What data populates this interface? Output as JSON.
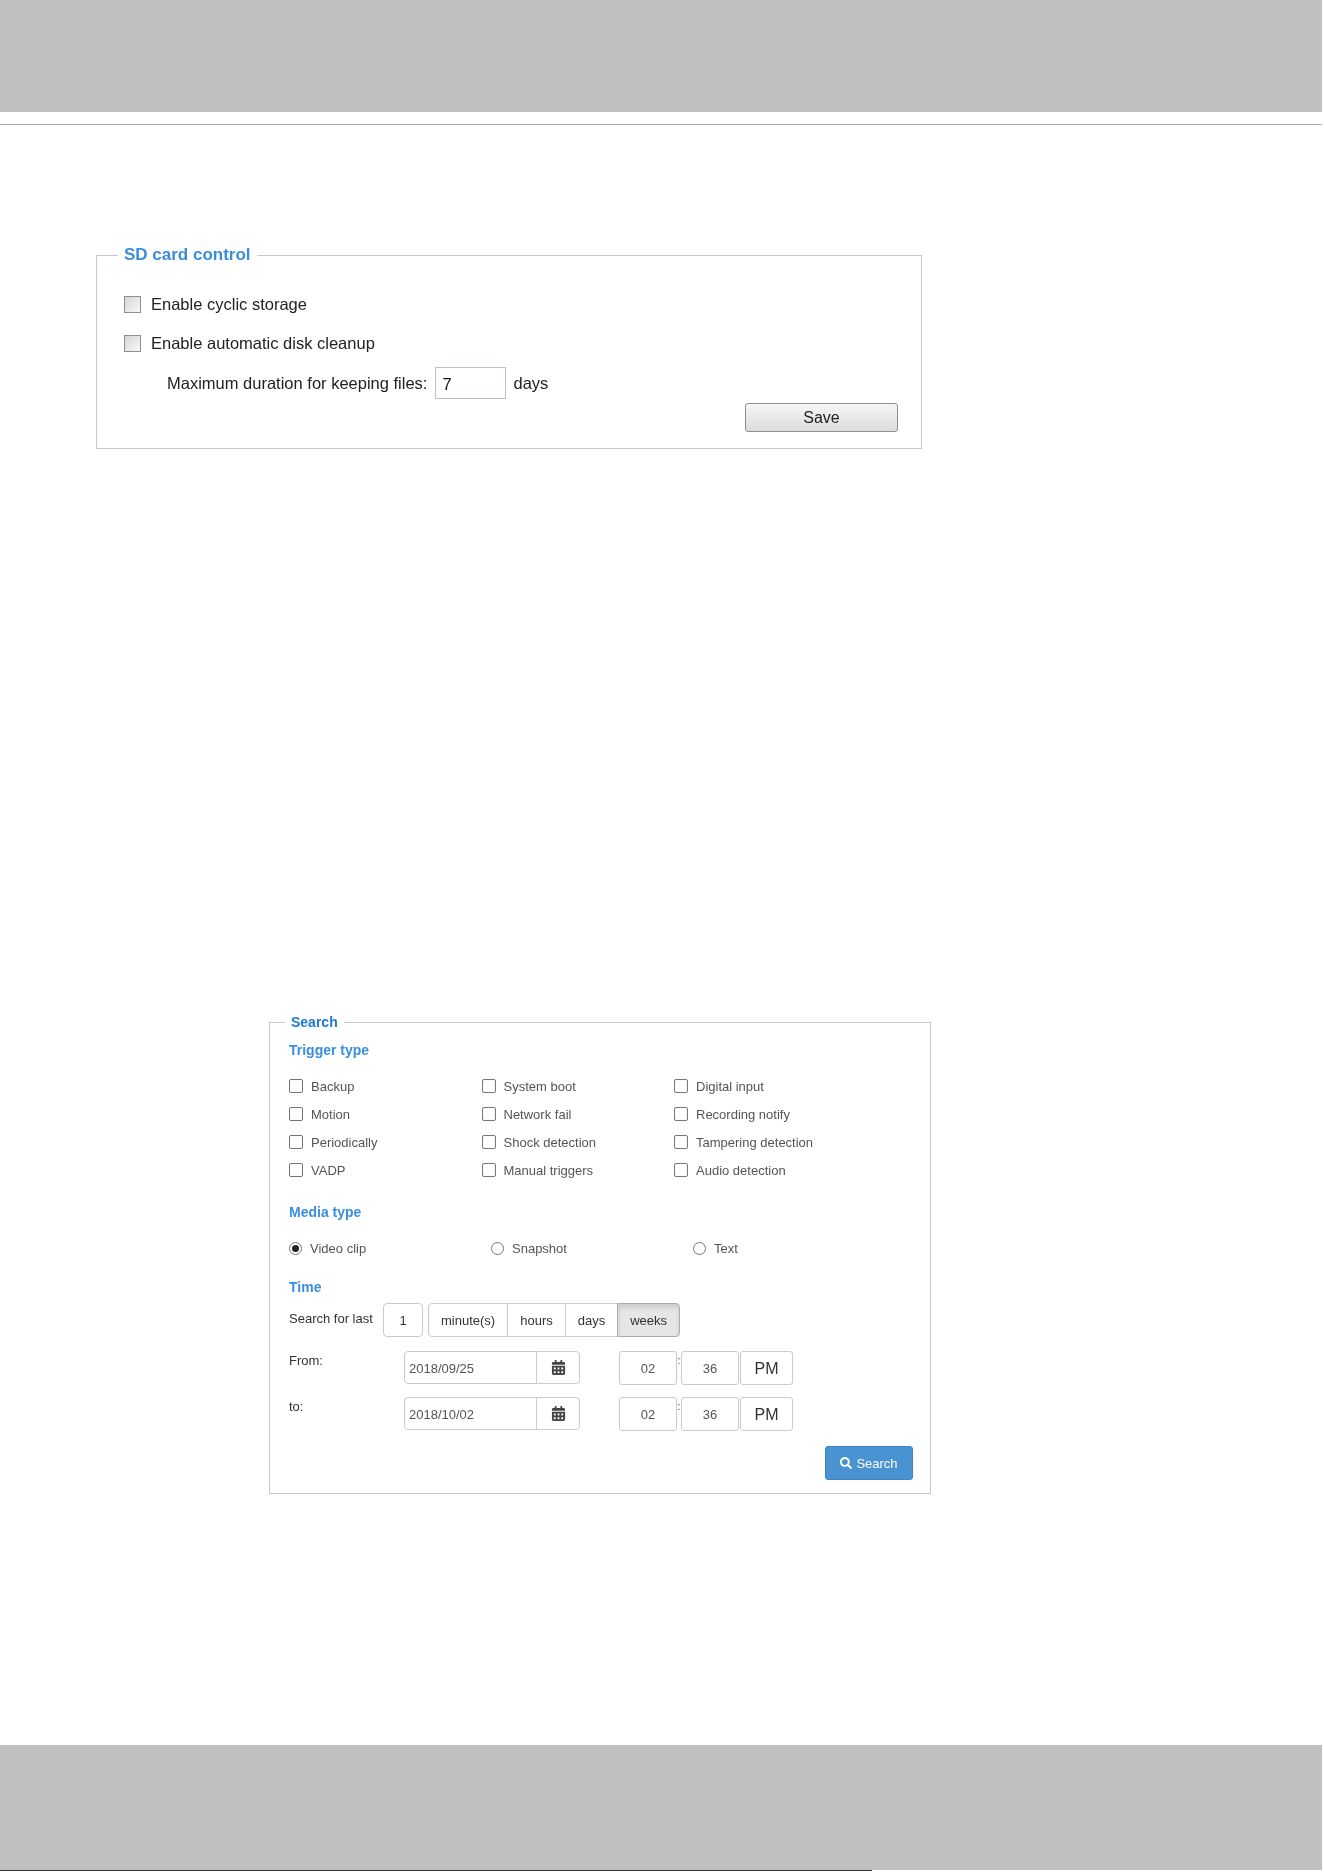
{
  "sd_card_control": {
    "title": "SD card control",
    "options": [
      {
        "label": "Enable cyclic storage",
        "checked": false
      },
      {
        "label": "Enable automatic disk cleanup",
        "checked": false
      }
    ],
    "retention": {
      "label": "Maximum duration for keeping files:",
      "value": "7",
      "unit": "days"
    },
    "save_button": "Save"
  },
  "search": {
    "title": "Search",
    "trigger_type": {
      "title": "Trigger type",
      "options": [
        {
          "label": "Backup",
          "checked": false
        },
        {
          "label": "System boot",
          "checked": false
        },
        {
          "label": "Digital input",
          "checked": false
        },
        {
          "label": "Motion",
          "checked": false
        },
        {
          "label": "Network fail",
          "checked": false
        },
        {
          "label": "Recording notify",
          "checked": false
        },
        {
          "label": "Periodically",
          "checked": false
        },
        {
          "label": "Shock detection",
          "checked": false
        },
        {
          "label": "Tampering detection",
          "checked": false
        },
        {
          "label": "VADP",
          "checked": false
        },
        {
          "label": "Manual triggers",
          "checked": false
        },
        {
          "label": "Audio detection",
          "checked": false
        }
      ]
    },
    "media_type": {
      "title": "Media type",
      "options": [
        {
          "label": "Video clip",
          "selected": true
        },
        {
          "label": "Snapshot",
          "selected": false
        },
        {
          "label": "Text",
          "selected": false
        }
      ]
    },
    "time": {
      "title": "Time",
      "search_for_last": {
        "label": "Search for last",
        "value": "1",
        "units": [
          {
            "label": "minute(s)",
            "selected": false
          },
          {
            "label": "hours",
            "selected": false
          },
          {
            "label": "days",
            "selected": false
          },
          {
            "label": "weeks",
            "selected": true
          }
        ]
      },
      "ranges": [
        {
          "label": "From:",
          "date": "2018/09/25",
          "hour": "02",
          "separator": ":",
          "minute": "36",
          "period": "PM"
        },
        {
          "label": "to:",
          "date": "2018/10/02",
          "hour": "02",
          "separator": ":",
          "minute": "36",
          "period": "PM"
        }
      ]
    },
    "search_button": "Search"
  }
}
